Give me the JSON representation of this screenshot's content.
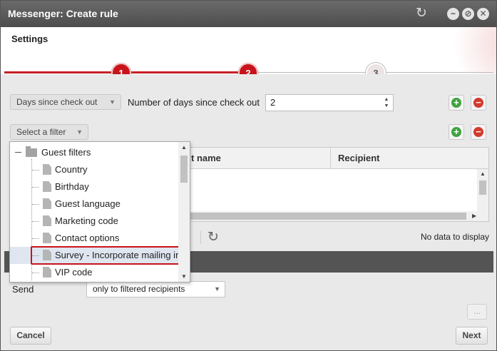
{
  "window": {
    "title": "Messenger: Create rule",
    "controls": [
      "refresh-icon",
      "minimize-icon",
      "restore-icon",
      "close-icon"
    ]
  },
  "settings": {
    "label": "Settings",
    "steps": [
      "1",
      "2",
      "3"
    ],
    "active_steps": 2
  },
  "criteria": {
    "type_select": "Days since check out",
    "number_label": "Number of days since check out",
    "number_value": "2",
    "filter_select": "Select a filter"
  },
  "filter_tree": {
    "group_label": "Guest filters",
    "items": [
      "Country",
      "Birthday",
      "Guest language",
      "Marketing code",
      "Contact options",
      "Survey - Incorporate mailing in",
      "VIP code"
    ],
    "highlighted_item": "Survey - Incorporate mailing in"
  },
  "grid": {
    "columns": [
      "t name",
      "Recipient"
    ],
    "empty_text": "No data to display"
  },
  "send": {
    "label": "Send",
    "value": "only to filtered recipients"
  },
  "footer": {
    "cancel_label": "Cancel",
    "next_label": "Next",
    "more_label": "..."
  },
  "colors": {
    "accent_red": "#c8141b",
    "add_green": "#3fa33f",
    "remove_red": "#d33a2c",
    "titlebar": "#555555"
  }
}
